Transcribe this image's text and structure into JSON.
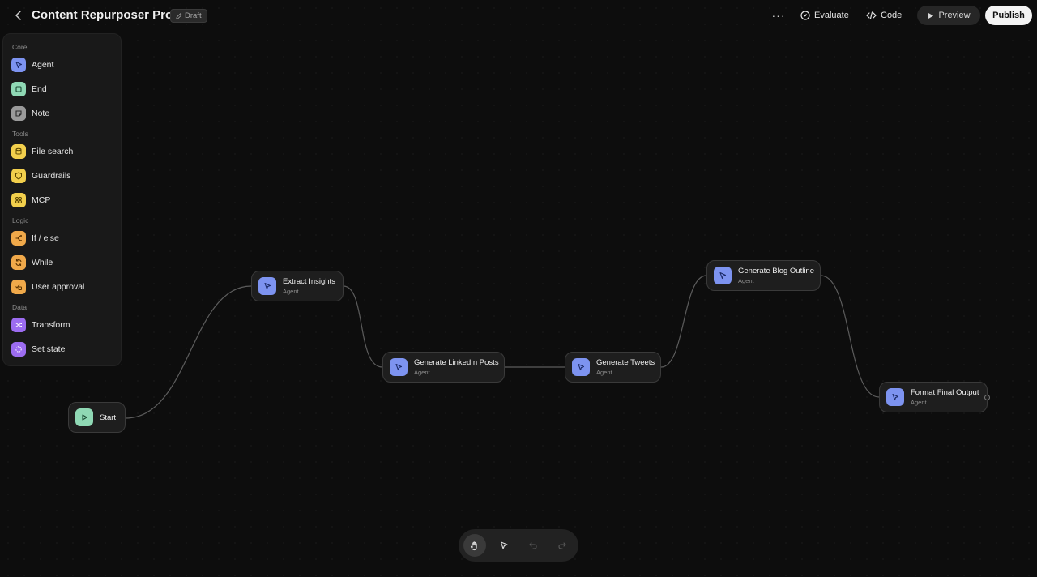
{
  "header": {
    "title": "Content Repurposer Pro",
    "badge": "Draft",
    "more_label": "···",
    "evaluate_label": "Evaluate",
    "code_label": "Code",
    "preview_label": "Preview",
    "publish_label": "Publish"
  },
  "sidebar": {
    "sections": [
      {
        "label": "Core",
        "items": [
          {
            "label": "Agent",
            "icon": "agent-icon",
            "color": "#7d93f0"
          },
          {
            "label": "End",
            "icon": "end-icon",
            "color": "#8fd8b4"
          },
          {
            "label": "Note",
            "icon": "note-icon",
            "color": "#9a9a9a"
          }
        ]
      },
      {
        "label": "Tools",
        "items": [
          {
            "label": "File search",
            "icon": "file-search-icon",
            "color": "#f2cf4c"
          },
          {
            "label": "Guardrails",
            "icon": "guardrails-icon",
            "color": "#f2cf4c"
          },
          {
            "label": "MCP",
            "icon": "mcp-icon",
            "color": "#f2cf4c"
          }
        ]
      },
      {
        "label": "Logic",
        "items": [
          {
            "label": "If / else",
            "icon": "if-else-icon",
            "color": "#f0a94a"
          },
          {
            "label": "While",
            "icon": "while-icon",
            "color": "#f0a94a"
          },
          {
            "label": "User approval",
            "icon": "user-approval-icon",
            "color": "#f0a94a"
          }
        ]
      },
      {
        "label": "Data",
        "items": [
          {
            "label": "Transform",
            "icon": "transform-icon",
            "color": "#9c6cf0"
          },
          {
            "label": "Set state",
            "icon": "set-state-icon",
            "color": "#9c6cf0"
          }
        ]
      }
    ]
  },
  "nodes": {
    "start": {
      "title": "Start",
      "icon": "play-icon",
      "color": "#8fd8b4"
    },
    "extract": {
      "title": "Extract Insights",
      "subtitle": "Agent"
    },
    "linkedin": {
      "title": "Generate LinkedIn Posts",
      "subtitle": "Agent"
    },
    "tweets": {
      "title": "Generate Tweets",
      "subtitle": "Agent"
    },
    "blog": {
      "title": "Generate Blog Outline",
      "subtitle": "Agent"
    },
    "format": {
      "title": "Format Final Output",
      "subtitle": "Agent"
    }
  },
  "toolbar": {
    "tools": [
      "hand-icon",
      "pointer-icon",
      "undo-icon",
      "redo-icon"
    ]
  }
}
